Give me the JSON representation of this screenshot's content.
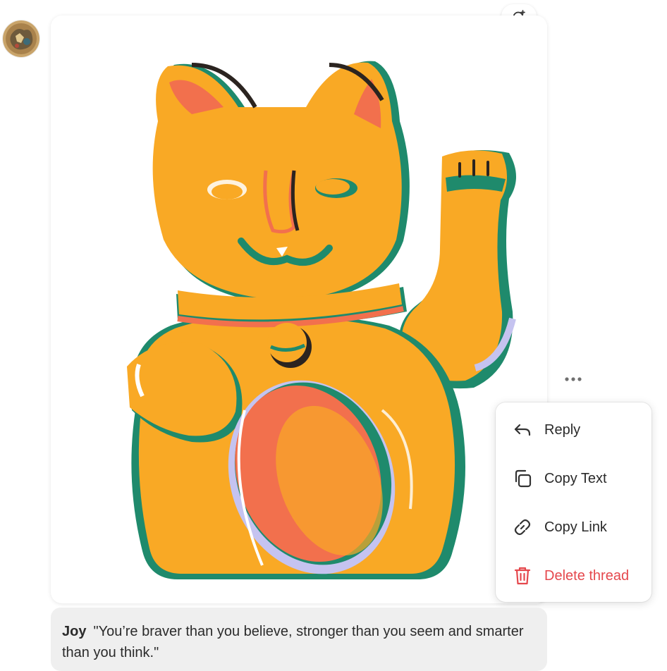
{
  "message": {
    "author": "Joy",
    "text": "\"You’re braver than you believe, stronger than you seem and smarter than you think.\""
  },
  "menu": {
    "items": [
      {
        "label": "Reply",
        "icon": "reply-icon"
      },
      {
        "label": "Copy Text",
        "icon": "copy-icon"
      },
      {
        "label": "Copy Link",
        "icon": "link-icon"
      },
      {
        "label": "Delete thread",
        "icon": "trash-icon"
      }
    ]
  },
  "colors": {
    "cat_yellow": "#f9a925",
    "cat_green": "#1f8a6c",
    "cat_coral": "#f2704d",
    "cat_lavender": "#c5c3f0",
    "danger": "#e5484d"
  }
}
